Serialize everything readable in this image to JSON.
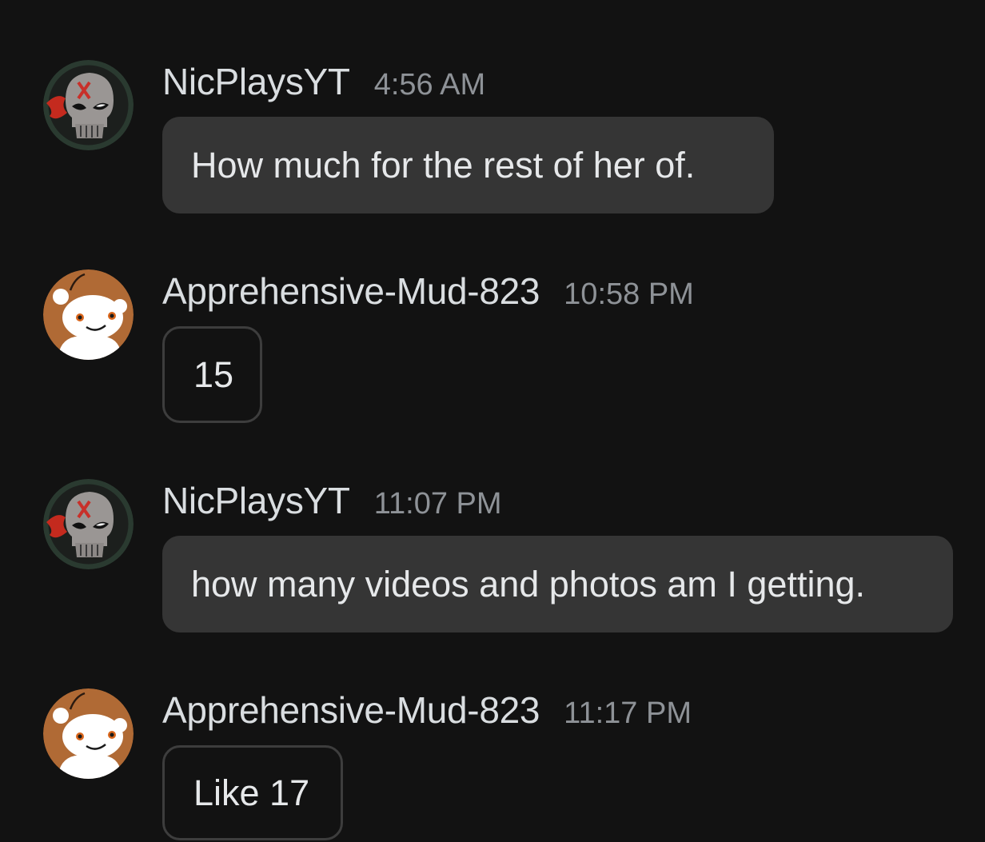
{
  "messages": [
    {
      "username": "NicPlaysYT",
      "time": "4:56 AM",
      "text": "How much for the rest of her of.",
      "avatar": "skull-avatar-icon",
      "style": "filled"
    },
    {
      "username": "Apprehensive-Mud-823",
      "time": "10:58 PM",
      "text": "15",
      "avatar": "snoo-avatar-icon",
      "style": "outline"
    },
    {
      "username": "NicPlaysYT",
      "time": "11:07 PM",
      "text": "how many videos and photos am I getting.",
      "avatar": "skull-avatar-icon",
      "style": "filled"
    },
    {
      "username": "Apprehensive-Mud-823",
      "time": "11:17 PM",
      "text": "Like 17",
      "avatar": "snoo-avatar-icon",
      "style": "outline"
    }
  ],
  "colors": {
    "background": "#121212",
    "bubble_filled": "#353535",
    "bubble_outline": "#3d3d3d",
    "username": "#d9dde0",
    "timestamp": "#8e9297",
    "snoo_ring": "#b06a35"
  }
}
